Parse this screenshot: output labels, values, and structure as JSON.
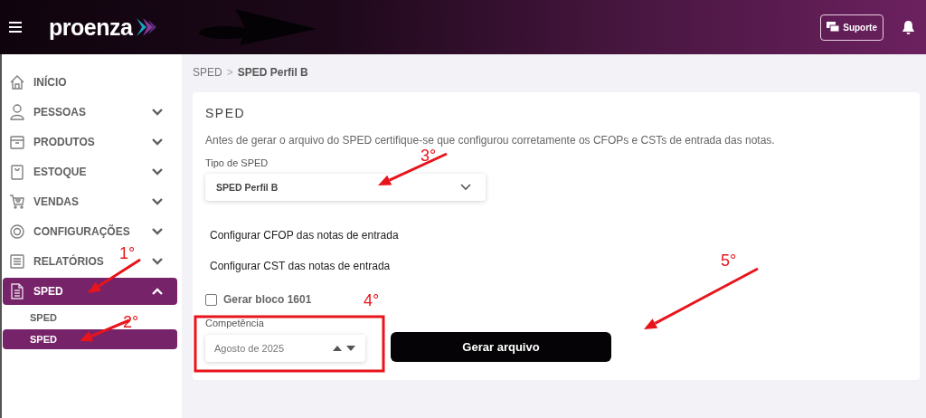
{
  "header": {
    "logo": "proenza",
    "support_button": "Suporte"
  },
  "sidebar": {
    "items": [
      {
        "label": "INÍCIO"
      },
      {
        "label": "PESSOAS",
        "expanded": false,
        "selected": false
      },
      {
        "label": "PRODUTOS",
        "expanded": false,
        "selected": false
      },
      {
        "label": "ESTOQUE",
        "expanded": false,
        "selected": false
      },
      {
        "label": "VENDAS",
        "expanded": false,
        "selected": false
      },
      {
        "label": "CONFIGURAÇÕES",
        "expanded": false,
        "selected": false
      },
      {
        "label": "RELATÓRIOS",
        "expanded": false,
        "selected": false
      },
      {
        "label": "SPED",
        "expanded": true,
        "selected": true,
        "children": [
          {
            "label": "SPED",
            "selected": false
          },
          {
            "label": "SPED",
            "selected": true
          }
        ]
      }
    ]
  },
  "breadcrumb": {
    "parent": "SPED",
    "separator": ">",
    "current": "SPED Perfil B"
  },
  "card": {
    "title": "SPED",
    "description": "Antes de gerar o arquivo do SPED certifique-se que configurou corretamente os CFOPs e CSTs de entrada das notas.",
    "type_label": "Tipo de SPED",
    "type_value": "SPED Perfil B",
    "links": [
      "Configurar CFOP das notas de entrada",
      "Configurar CST das notas de entrada"
    ],
    "checkbox": {
      "label": "Gerar bloco 1601",
      "checked": false
    },
    "period_label": "Competência",
    "period_value": "Agosto de 2025",
    "generate_button": "Gerar arquivo"
  },
  "annotations": [
    {
      "label": "1°"
    },
    {
      "label": "2°"
    },
    {
      "label": "3°"
    },
    {
      "label": "4°"
    },
    {
      "label": "5°"
    }
  ]
}
